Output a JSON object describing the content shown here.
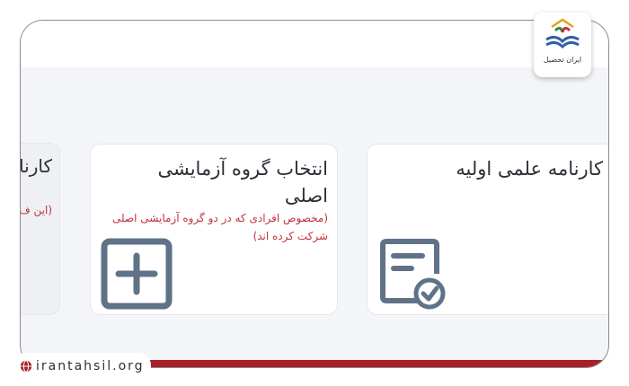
{
  "cards": [
    {
      "title": "کارنامه علمی اولیه",
      "note": "",
      "icon": "certificate-check-icon"
    },
    {
      "title": "انتخاب گروه آزمایشی اصلی",
      "note": "(مخصوص افرادی که در دو گروه آزمایشی اصلی شرکت کرده اند)",
      "icon": "plus-square-icon"
    },
    {
      "title": "کارنامه انتخاب",
      "note": "(این ف",
      "icon": ""
    }
  ],
  "branding": {
    "logo_text": "ایران تحصیل",
    "website": "irantahsil.org"
  },
  "colors": {
    "accent": "#a8202a",
    "note": "#c4313a",
    "icon": "#5f7288"
  }
}
